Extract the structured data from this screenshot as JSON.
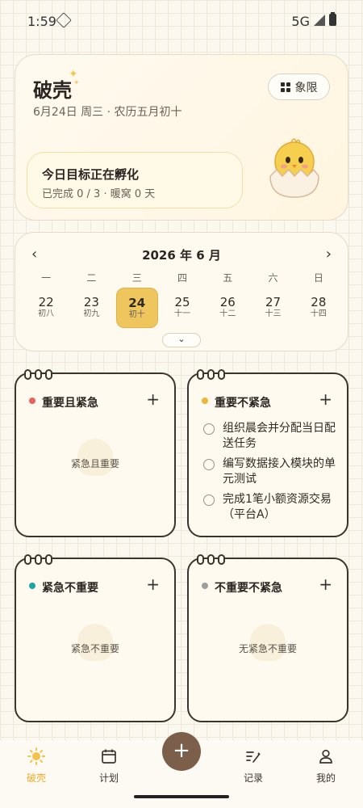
{
  "status": {
    "time": "1:59",
    "network": "5G"
  },
  "hero": {
    "title": "破壳",
    "date": "6月24日 周三 · 农历五月初十",
    "quadrant_button": "象限",
    "goal_title": "今日目标正在孵化",
    "goal_sub": "已完成 0 / 3 · 暖窝 0 天"
  },
  "calendar": {
    "month": "2026 年 6 月",
    "prev": "‹",
    "next": "›",
    "weekdays": [
      "一",
      "二",
      "三",
      "四",
      "五",
      "六",
      "日"
    ],
    "days": [
      {
        "num": "22",
        "lunar": "初八"
      },
      {
        "num": "23",
        "lunar": "初九"
      },
      {
        "num": "24",
        "lunar": "初十"
      },
      {
        "num": "25",
        "lunar": "十一"
      },
      {
        "num": "26",
        "lunar": "十二"
      },
      {
        "num": "27",
        "lunar": "十三"
      },
      {
        "num": "28",
        "lunar": "十四"
      }
    ],
    "selected_index": 2,
    "expand": "⌄"
  },
  "quadrants": {
    "q1": {
      "title": "重要且紧急",
      "color": "#e8635a",
      "empty": "紧急且重要"
    },
    "q2": {
      "title": "重要不紧急",
      "color": "#f0b43a",
      "tasks": [
        "组织晨会并分配当日配送任务",
        "编写数据接入模块的单元测试",
        "完成1笔小额资源交易（平台A）"
      ]
    },
    "q3": {
      "title": "紧急不重要",
      "color": "#1aa7a0",
      "empty": "紧急不重要"
    },
    "q4": {
      "title": "不重要不紧急",
      "color": "#9e9e9e",
      "empty": "无紧急不重要"
    }
  },
  "nav": {
    "home": "破壳",
    "plan": "计划",
    "record": "记录",
    "mine": "我的",
    "fab": "+"
  },
  "colors": {
    "accent": "#efc55e",
    "fab": "#7c5f4b",
    "active_tab": "#e8ab2e"
  }
}
